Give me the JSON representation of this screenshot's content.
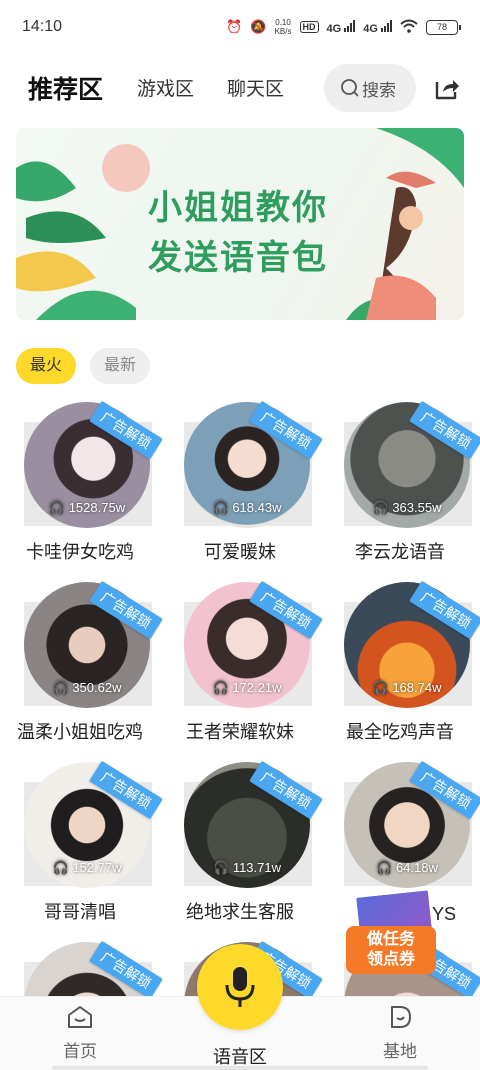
{
  "status_bar": {
    "time": "14:10",
    "net_speed_value": "0.10",
    "net_speed_unit": "KB/s",
    "hd_label": "HD",
    "signal1": "4G",
    "signal2": "4G",
    "battery": "78"
  },
  "top_nav": {
    "tabs": [
      {
        "label": "推荐区",
        "active": true
      },
      {
        "label": "游戏区",
        "active": false
      },
      {
        "label": "聊天区",
        "active": false
      }
    ],
    "search_label": "搜索"
  },
  "banner": {
    "line1": "小姐姐教你",
    "line2": "发送语音包"
  },
  "filters": {
    "hot": "最火",
    "new": "最新"
  },
  "ad_tag": "广告解锁",
  "cards": [
    {
      "title": "卡哇伊女吃鸡",
      "count": "1528.75w"
    },
    {
      "title": "可爱暖妹",
      "count": "618.43w"
    },
    {
      "title": "李云龙语音",
      "count": "363.55w"
    },
    {
      "title": "温柔小姐姐吃鸡",
      "count": "350.62w"
    },
    {
      "title": "王者荣耀软妹",
      "count": "172.21w"
    },
    {
      "title": "最全吃鸡声音",
      "count": "168.74w"
    },
    {
      "title": "哥哥清唱",
      "count": "152.77w"
    },
    {
      "title": "绝地求生客服",
      "count": "113.71w"
    },
    {
      "title": "",
      "count": "64.18w"
    },
    {
      "title": "",
      "count": ""
    },
    {
      "title": "",
      "count": ""
    },
    {
      "title": "",
      "count": ""
    }
  ],
  "promo": {
    "line1": "做任务",
    "line2": "领点券",
    "side_text": "YS"
  },
  "bottom_nav": {
    "home": "首页",
    "voice": "语音区",
    "base": "基地"
  },
  "colors": {
    "accent_yellow": "#ffd929",
    "ad_blue": "#4aa7f2",
    "banner_green": "#2e9d5d",
    "promo_orange": "#f47a2a"
  }
}
